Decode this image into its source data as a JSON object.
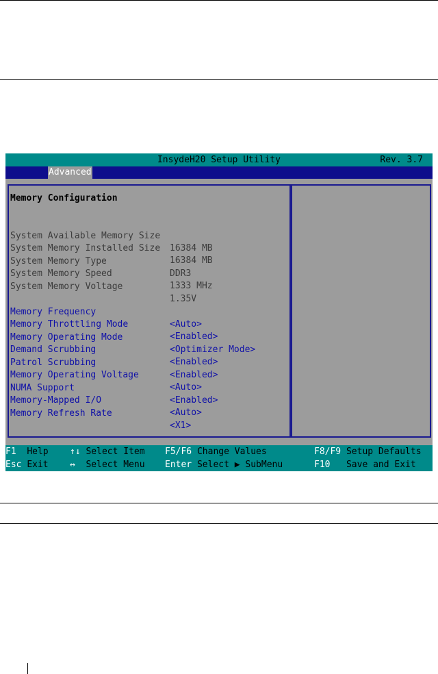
{
  "bios": {
    "title": "InsydeH20 Setup Utility",
    "revision": "Rev. 3.7",
    "active_tab": "Advanced",
    "section_heading": "Memory Configuration",
    "info_items": [
      {
        "label": "System Available Memory Size",
        "value": "16384 MB"
      },
      {
        "label": "System Memory Installed Size",
        "value": "16384 MB"
      },
      {
        "label": "System Memory Type",
        "value": "DDR3"
      },
      {
        "label": "System Memory Speed",
        "value": "1333 MHz"
      },
      {
        "label": "System Memory Voltage",
        "value": "1.35V"
      }
    ],
    "settings": [
      {
        "label": "Memory Frequency",
        "value": "<Auto>"
      },
      {
        "label": "Memory Throttling Mode",
        "value": "<Enabled>"
      },
      {
        "label": "Memory Operating Mode",
        "value": "<Optimizer Mode>"
      },
      {
        "label": "Demand Scrubbing",
        "value": "<Enabled>"
      },
      {
        "label": "Patrol Scrubbing",
        "value": "<Enabled>"
      },
      {
        "label": "Memory Operating Voltage",
        "value": "<Auto>"
      },
      {
        "label": "NUMA Support",
        "value": "<Enabled>"
      },
      {
        "label": "Memory-Mapped I/O",
        "value": "<Auto>"
      },
      {
        "label": "Memory Refresh Rate",
        "value": "<X1>"
      }
    ],
    "footer": [
      {
        "key": "F1",
        "desc": "Help"
      },
      {
        "key": "↑↓",
        "desc": "Select Item"
      },
      {
        "key": "F5/F6",
        "desc": "Change Values"
      },
      {
        "key": "F8/F9",
        "desc": "Setup Defaults"
      },
      {
        "key": "Esc",
        "desc": "Exit"
      },
      {
        "key": "↔",
        "desc": "Select Menu"
      },
      {
        "key": "Enter",
        "desc": "Select ▶ SubMenu"
      },
      {
        "key": "F10",
        "desc": "Save and Exit"
      }
    ],
    "colors": {
      "screen_bg": "#9c9c9c",
      "bar_teal": "#008a8a",
      "menu_blue": "#0e0e8c",
      "option_blue": "#0f10a8",
      "info_gray": "#3c3c3c"
    }
  }
}
